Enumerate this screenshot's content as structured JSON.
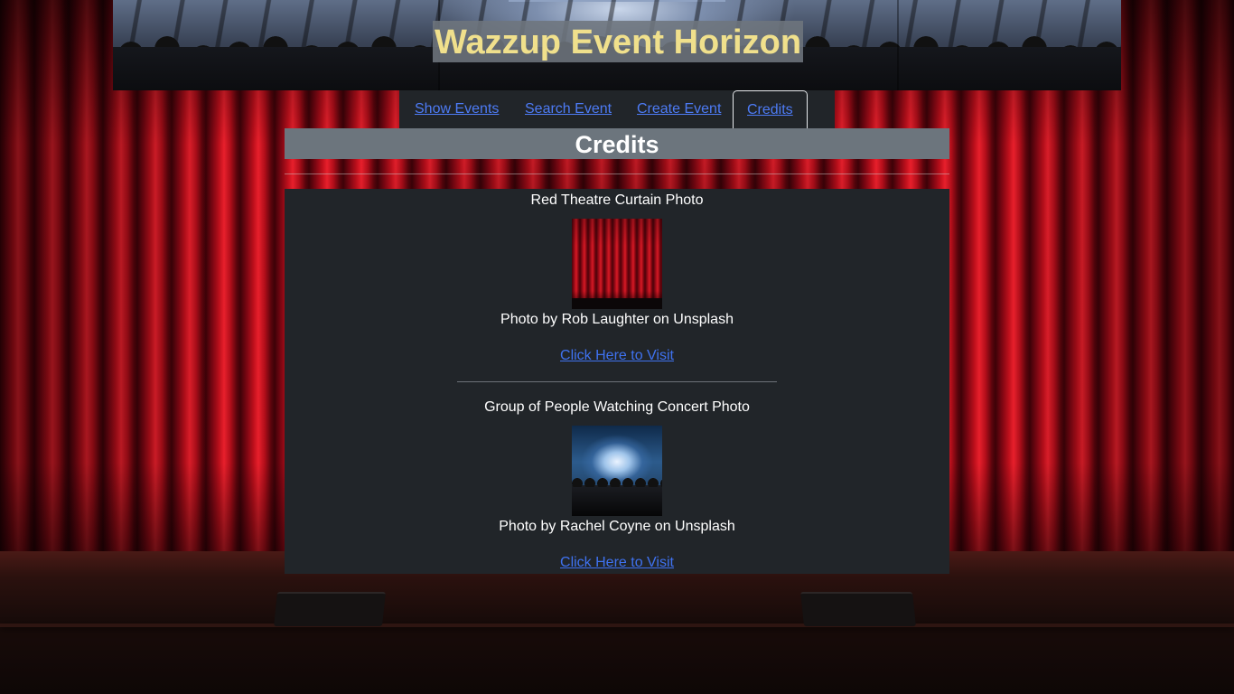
{
  "header": {
    "title": "Wazzup Event Horizon"
  },
  "nav": {
    "tabs": [
      {
        "label": "Show Events"
      },
      {
        "label": "Search Event"
      },
      {
        "label": "Create Event"
      },
      {
        "label": "Credits",
        "active": true
      }
    ]
  },
  "page": {
    "heading": "Credits"
  },
  "credits": [
    {
      "title": "Red Theatre Curtain Photo",
      "image_icon": "red-curtain-thumbnail",
      "author": "Photo by Rob Laughter on Unsplash",
      "link_text": "Click Here to Visit"
    },
    {
      "title": "Group of People Watching Concert Photo",
      "image_icon": "concert-crowd-thumbnail",
      "author": "Photo by Rachel Coyne on Unsplash",
      "link_text": "Click Here to Visit"
    }
  ],
  "colors": {
    "title_text": "#f0e08c",
    "title_bg": "#6c757d",
    "nav_bg": "#212529",
    "link": "#3f72f0",
    "panel_bg": "#212529",
    "heading_bg": "#6c757d"
  }
}
